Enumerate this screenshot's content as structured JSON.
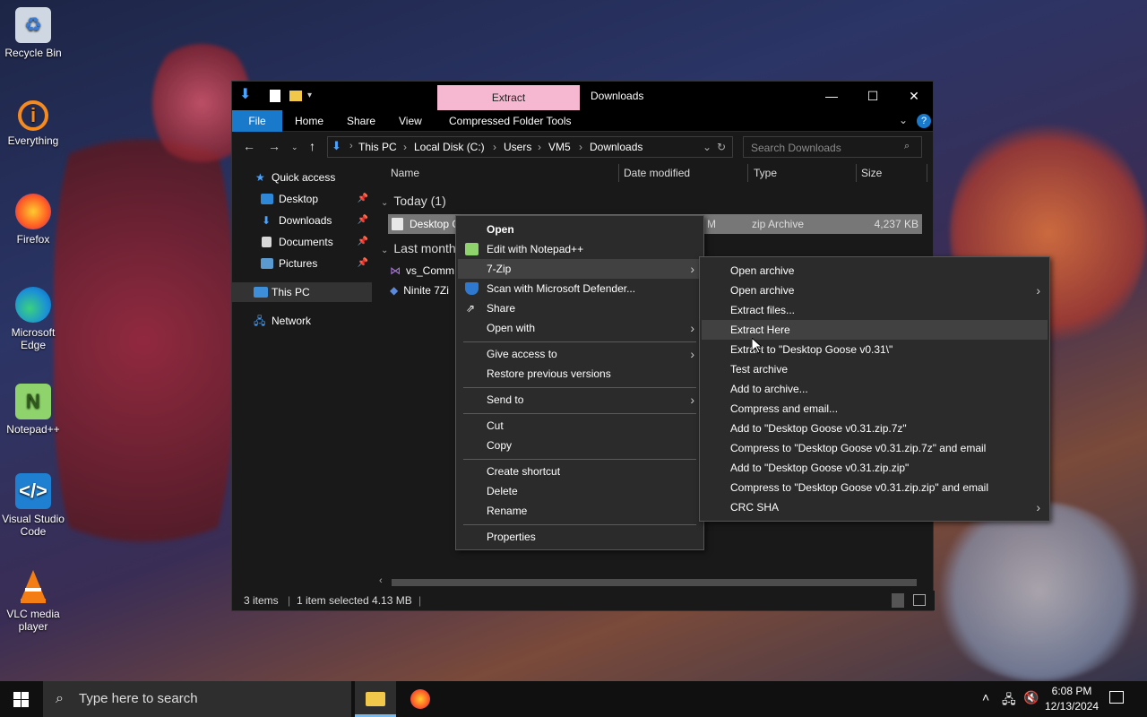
{
  "desktop": {
    "icons": [
      {
        "label": "Recycle Bin"
      },
      {
        "label": "Everything"
      },
      {
        "label": "Firefox"
      },
      {
        "label": "Microsoft Edge"
      },
      {
        "label": "Notepad++"
      },
      {
        "label": "Visual Studio Code"
      },
      {
        "label": "VLC media player"
      }
    ]
  },
  "explorer": {
    "context_tab": "Extract",
    "title": "Downloads",
    "ribbon_tabs": [
      "File",
      "Home",
      "Share",
      "View",
      "Compressed Folder Tools"
    ],
    "breadcrumb": [
      "This PC",
      "Local Disk (C:)",
      "Users",
      "VM5",
      "Downloads"
    ],
    "search_placeholder": "Search Downloads",
    "nav": {
      "quick_access": "Quick access",
      "items": [
        "Desktop",
        "Downloads",
        "Documents",
        "Pictures"
      ],
      "this_pc": "This PC",
      "network": "Network"
    },
    "columns": [
      "Name",
      "Date modified",
      "Type",
      "Size"
    ],
    "groups": {
      "today": "Today (1)",
      "last_month": "Last month"
    },
    "files": [
      {
        "name": "Desktop G",
        "date": "M",
        "type": "zip Archive",
        "size": "4,237 KB"
      },
      {
        "name": "vs_Comm"
      },
      {
        "name": "Ninite 7Zi"
      }
    ],
    "status": {
      "items": "3 items",
      "selected": "1 item selected  4.13 MB"
    }
  },
  "context_menu": {
    "items": [
      {
        "label": "Open",
        "bold": true
      },
      {
        "label": "Edit with Notepad++"
      },
      {
        "label": "7-Zip"
      },
      {
        "label": "Scan with Microsoft Defender..."
      },
      {
        "label": "Share"
      },
      {
        "label": "Open with"
      },
      {
        "label": "Give access to"
      },
      {
        "label": "Restore previous versions"
      },
      {
        "label": "Send to"
      },
      {
        "label": "Cut"
      },
      {
        "label": "Copy"
      },
      {
        "label": "Create shortcut"
      },
      {
        "label": "Delete"
      },
      {
        "label": "Rename"
      },
      {
        "label": "Properties"
      }
    ]
  },
  "zip_menu": {
    "items": [
      "Open archive",
      "Open archive",
      "Extract files...",
      "Extract Here",
      "Extract to \"Desktop Goose v0.31\\\"",
      "Test archive",
      "Add to archive...",
      "Compress and email...",
      "Add to \"Desktop Goose v0.31.zip.7z\"",
      "Compress to \"Desktop Goose v0.31.zip.7z\" and email",
      "Add to \"Desktop Goose v0.31.zip.zip\"",
      "Compress to \"Desktop Goose v0.31.zip.zip\" and email",
      "CRC SHA"
    ]
  },
  "taskbar": {
    "search_placeholder": "Type here to search",
    "time": "6:08 PM",
    "date": "12/13/2024"
  },
  "colors": {
    "accent": "#1979ca",
    "extract_tab": "#f6b8d0",
    "menu_bg": "#2b2b2b",
    "highlight": "#414141"
  }
}
